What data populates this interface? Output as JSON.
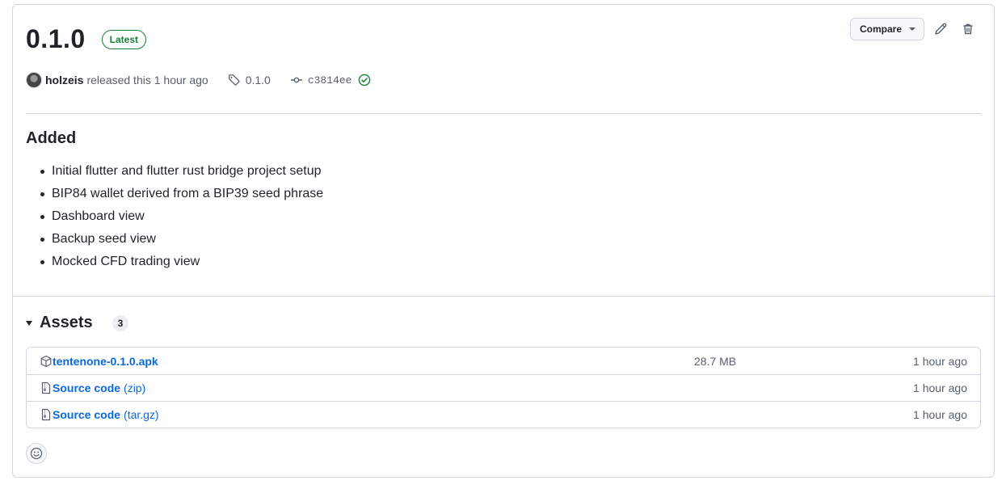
{
  "release": {
    "version": "0.1.0",
    "latest_label": "Latest",
    "author": "holzeis",
    "released_text": "released this 1 hour ago",
    "tag": "0.1.0",
    "commit": "c3814ee",
    "compare_label": "Compare"
  },
  "notes": {
    "heading": "Added",
    "items": [
      "Initial flutter and flutter rust bridge project setup",
      "BIP84 wallet derived from a BIP39 seed phrase",
      "Dashboard view",
      "Backup seed view",
      "Mocked CFD trading view"
    ]
  },
  "assets": {
    "title": "Assets",
    "count": "3",
    "items": [
      {
        "name": "tenten​one-0.1.0.apk",
        "suffix": "",
        "size": "28.7 MB",
        "time": "1 hour ago",
        "icon": "package-icon"
      },
      {
        "name": "Source code",
        "suffix": "(zip)",
        "size": "",
        "time": "1 hour ago",
        "icon": "file-zip-icon"
      },
      {
        "name": "Source code",
        "suffix": "(tar.gz)",
        "size": "",
        "time": "1 hour ago",
        "icon": "file-zip-icon"
      }
    ]
  },
  "colors": {
    "accent": "#0969da",
    "success": "#1a7f37",
    "border": "#d0d7de",
    "muted": "#57606a"
  }
}
